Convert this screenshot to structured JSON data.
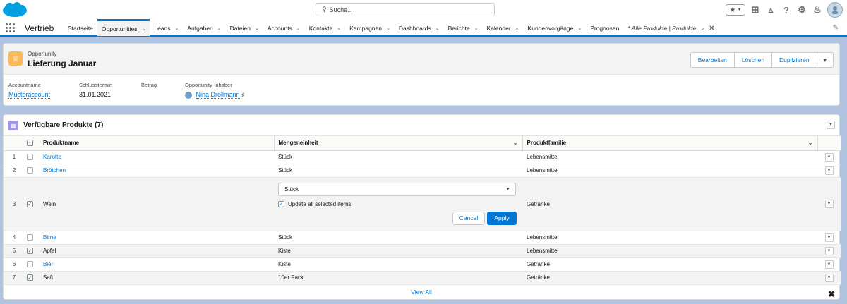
{
  "header": {
    "search_placeholder": "Suche...",
    "brand_color": "#00a1e0"
  },
  "nav": {
    "app_name": "Vertrieb",
    "items": [
      {
        "label": "Startseite",
        "chevron": false
      },
      {
        "label": "Opportunities",
        "chevron": true,
        "active": true
      },
      {
        "label": "Leads",
        "chevron": true
      },
      {
        "label": "Aufgaben",
        "chevron": true
      },
      {
        "label": "Dateien",
        "chevron": true
      },
      {
        "label": "Accounts",
        "chevron": true
      },
      {
        "label": "Kontakte",
        "chevron": true
      },
      {
        "label": "Kampagnen",
        "chevron": true
      },
      {
        "label": "Dashboards",
        "chevron": true
      },
      {
        "label": "Berichte",
        "chevron": true
      },
      {
        "label": "Kalender",
        "chevron": true
      },
      {
        "label": "Kundenvorgänge",
        "chevron": true
      },
      {
        "label": "Prognosen",
        "chevron": false
      }
    ],
    "open_tab": "* Alle Produkte | Produkte"
  },
  "record": {
    "type": "Opportunity",
    "name": "Lieferung Januar",
    "buttons": {
      "edit": "Bearbeiten",
      "delete": "Löschen",
      "clone": "Duplizieren"
    },
    "highlights": {
      "account_label": "Accountname",
      "account_value": "Musteraccount",
      "close_label": "Schlusstermin",
      "close_value": "31.01.2021",
      "amount_label": "Betrag",
      "amount_value": "",
      "owner_label": "Opportunity-Inhaber",
      "owner_value": "Nina Drollmann"
    }
  },
  "related": {
    "title": "Verfügbare Produkte (7)",
    "columns": {
      "name": "Produktname",
      "unit": "Mengeneinheit",
      "family": "Produktfamilie"
    },
    "rows": [
      {
        "num": "1",
        "name": "Karotte",
        "unit": "Stück",
        "family": "Lebensmittel"
      },
      {
        "num": "2",
        "name": "Brötchen",
        "unit": "Stück",
        "family": "Lebensmittel"
      },
      {
        "num": "3",
        "name": "Wein",
        "unit": "",
        "family": "Getränke"
      },
      {
        "num": "4",
        "name": "Birne",
        "unit": "Stück",
        "family": "Lebensmittel"
      },
      {
        "num": "5",
        "name": "Apfel",
        "unit": "Kiste",
        "family": "Lebensmittel"
      },
      {
        "num": "6",
        "name": "Bier",
        "unit": "Kiste",
        "family": "Getränke"
      },
      {
        "num": "7",
        "name": "Saft",
        "unit": "10er Pack",
        "family": "Getränke"
      }
    ],
    "inline_edit": {
      "selected_value": "Stück",
      "update_all_label": "Update all selected items",
      "cancel": "Cancel",
      "apply": "Apply"
    },
    "view_all": "View All"
  }
}
